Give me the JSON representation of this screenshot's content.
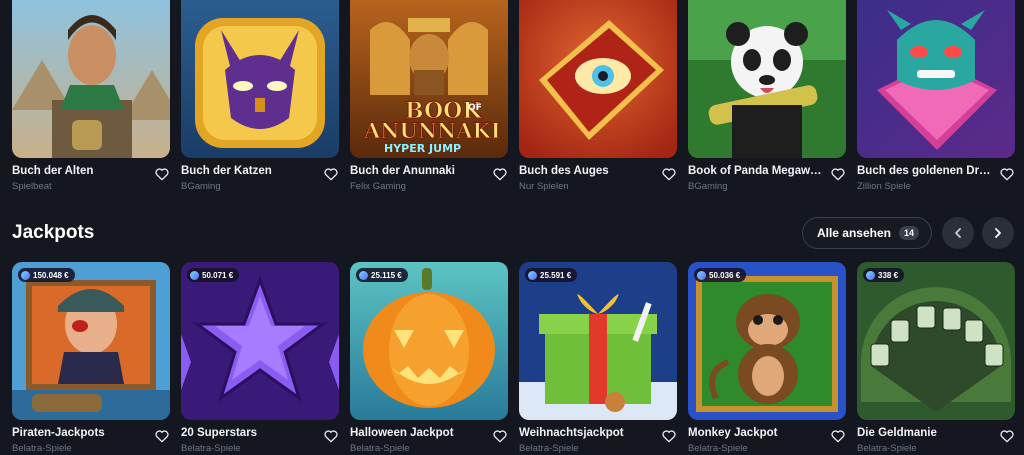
{
  "top_games": [
    {
      "title": "Buch der Alten",
      "provider": "Spielbeat"
    },
    {
      "title": "Buch der Katzen",
      "provider": "BGaming"
    },
    {
      "title": "Buch der Anunnaki",
      "provider": "Felix Gaming"
    },
    {
      "title": "Buch des Auges",
      "provider": "Nur Spielen"
    },
    {
      "title": "Book of Panda Megaways",
      "provider": "BGaming"
    },
    {
      "title": "Buch des goldenen Drachen",
      "provider": "Zillion Spiele"
    }
  ],
  "thumb_texts": {
    "anunnaki_line1": "BOOK",
    "anunnaki_of": "OF",
    "anunnaki_line2": "ANUNNAKI",
    "anunnaki_line3": "HYPER JUMP"
  },
  "jackpots": {
    "title": "Jackpots",
    "see_all_label": "Alle ansehen",
    "see_all_count": "14",
    "games": [
      {
        "title": "Piraten-Jackpots",
        "provider": "Belatra-Spiele",
        "jackpot": "150.048 €"
      },
      {
        "title": "20 Superstars",
        "provider": "Belatra-Spiele",
        "jackpot": "50.071 €"
      },
      {
        "title": "Halloween Jackpot",
        "provider": "Belatra-Spiele",
        "jackpot": "25.115 €"
      },
      {
        "title": "Weihnachtsjackpot",
        "provider": "Belatra-Spiele",
        "jackpot": "25.591 €"
      },
      {
        "title": "Monkey Jackpot",
        "provider": "Belatra-Spiele",
        "jackpot": "50.036 €"
      },
      {
        "title": "Die Geldmanie",
        "provider": "Belatra-Spiele",
        "jackpot": "338 €"
      }
    ]
  },
  "icons": {
    "heart": "heart-outline-icon",
    "prev": "chevron-left-icon",
    "next": "chevron-right-icon",
    "coin": "coin-icon"
  },
  "colors": {
    "background": "#14171f",
    "text_primary": "#f2f3f7",
    "text_secondary": "#6f7686",
    "button_bg": "#2b2f3a"
  }
}
